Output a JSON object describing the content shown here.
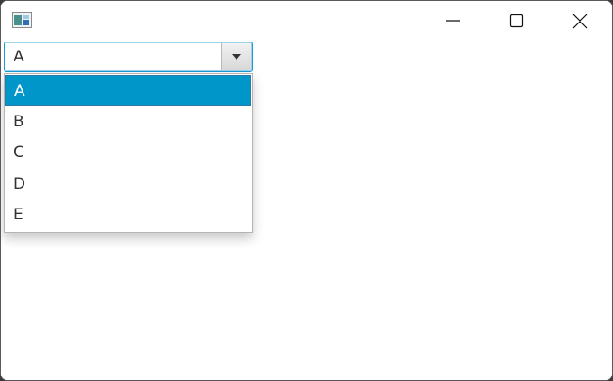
{
  "window": {
    "icon": "application-icon",
    "controls": {
      "minimize_icon": "minimize-icon",
      "maximize_icon": "maximize-icon",
      "close_icon": "close-icon"
    }
  },
  "combo": {
    "value": "A",
    "arrow_icon": "chevron-down-icon",
    "options": [
      "A",
      "B",
      "C",
      "D",
      "E"
    ],
    "selected_index": 0
  },
  "colors": {
    "focus_border": "#1a9bd5",
    "selected_option": "#0096c9"
  }
}
